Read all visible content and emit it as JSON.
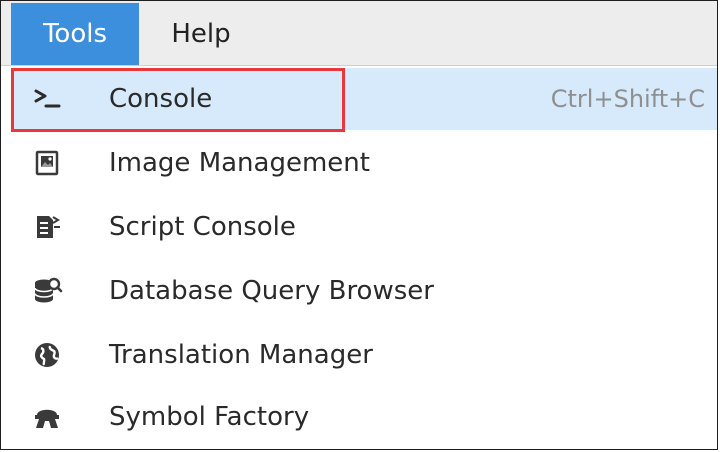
{
  "menubar": {
    "items": [
      {
        "label": "Tools",
        "active": true
      },
      {
        "label": "Help",
        "active": false
      }
    ]
  },
  "menu": {
    "items": [
      {
        "label": "Console",
        "shortcut": "Ctrl+Shift+C",
        "icon": "terminal-icon",
        "selected": true
      },
      {
        "label": "Image Management",
        "shortcut": "",
        "icon": "image-icon",
        "selected": false
      },
      {
        "label": "Script Console",
        "shortcut": "",
        "icon": "script-console-icon",
        "selected": false
      },
      {
        "label": "Database Query Browser",
        "shortcut": "",
        "icon": "database-search-icon",
        "selected": false
      },
      {
        "label": "Translation Manager",
        "shortcut": "",
        "icon": "globe-icon",
        "selected": false
      },
      {
        "label": "Symbol Factory",
        "shortcut": "",
        "icon": "symbol-factory-icon",
        "selected": false
      }
    ]
  },
  "colors": {
    "menubar_bg": "#ededed",
    "active_menu_bg": "#3c8fdc",
    "selected_item_bg": "#d6eafb",
    "annotation_border": "#e8383c",
    "icon_color": "#3a3a3a"
  }
}
